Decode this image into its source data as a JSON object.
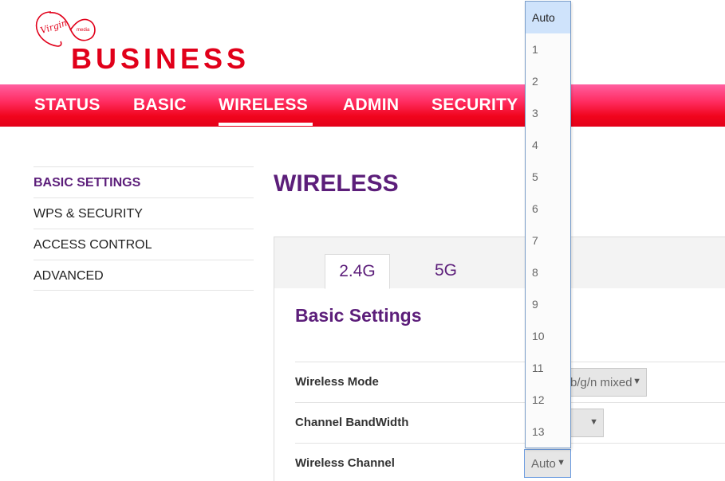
{
  "brand": {
    "logo_script": "Virgin",
    "logo_media": "media",
    "logo_word": "BUSINESS",
    "brand_color": "#e1001a"
  },
  "nav": {
    "items": [
      {
        "label": "STATUS"
      },
      {
        "label": "BASIC"
      },
      {
        "label": "WIRELESS"
      },
      {
        "label": "ADMIN"
      },
      {
        "label": "SECURITY"
      }
    ],
    "active": "WIRELESS"
  },
  "sidebar": {
    "items": [
      {
        "label": "BASIC SETTINGS"
      },
      {
        "label": "WPS & SECURITY"
      },
      {
        "label": "ACCESS CONTROL"
      },
      {
        "label": "ADVANCED"
      }
    ],
    "active": "BASIC SETTINGS",
    "accent_color": "#5c1e7a"
  },
  "page": {
    "title": "WIRELESS"
  },
  "tabs": [
    {
      "label": "2.4G"
    },
    {
      "label": "5G"
    }
  ],
  "section": {
    "title": "Basic Settings"
  },
  "rows": [
    {
      "label": "Wireless Mode",
      "value": "b/g/n mixed"
    },
    {
      "label": "Channel BandWidth",
      "value": ""
    },
    {
      "label": "Wireless Channel",
      "value": "Auto"
    }
  ],
  "channel_dropdown": {
    "options": [
      "Auto",
      "1",
      "2",
      "3",
      "4",
      "5",
      "6",
      "7",
      "8",
      "9",
      "10",
      "11",
      "12",
      "13"
    ],
    "selected": "Auto"
  },
  "icons": {
    "select_arrow": "triangle-down-icon"
  }
}
